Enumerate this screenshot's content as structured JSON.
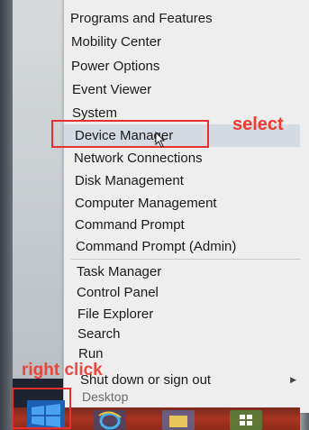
{
  "menu": {
    "items": [
      {
        "label": "Programs and Features"
      },
      {
        "label": "Mobility Center"
      },
      {
        "label": "Power Options"
      },
      {
        "label": "Event Viewer"
      },
      {
        "label": "System"
      },
      {
        "label": "Device Manager"
      },
      {
        "label": "Network Connections"
      },
      {
        "label": "Disk Management"
      },
      {
        "label": "Computer Management"
      },
      {
        "label": "Command Prompt"
      },
      {
        "label": "Command Prompt (Admin)"
      },
      {
        "label": "Task Manager"
      },
      {
        "label": "Control Panel"
      },
      {
        "label": "File Explorer"
      },
      {
        "label": "Search"
      },
      {
        "label": "Run"
      },
      {
        "label": "Shut down or sign out"
      },
      {
        "label": "Desktop"
      }
    ]
  },
  "annotations": {
    "select_label": "select",
    "right_click_label": "right click",
    "highlight_color": "#e8312f"
  },
  "taskbar": {
    "icons": [
      "start-icon",
      "internet-explorer-icon",
      "file-explorer-icon",
      "store-icon"
    ]
  }
}
